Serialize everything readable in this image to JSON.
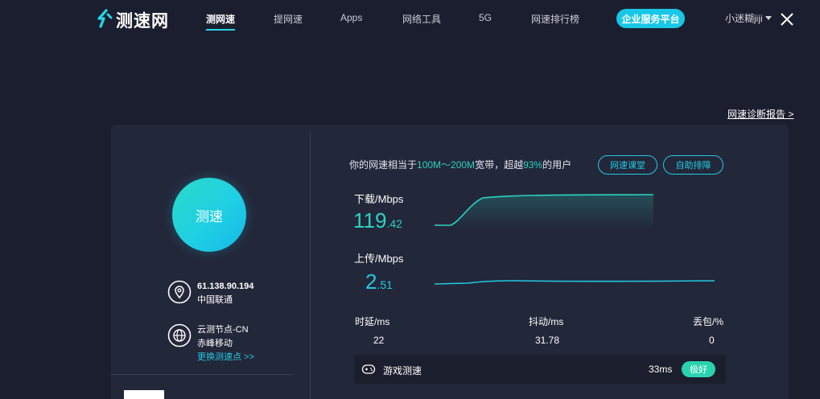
{
  "header": {
    "logo_text": "测速网",
    "nav": [
      "测网速",
      "提网速",
      "Apps",
      "网络工具",
      "5G",
      "网速排行榜"
    ],
    "active_nav": "测网速",
    "enterprise_button": "企业服务平台",
    "user_name": "小迷糊jiji",
    "icons": {
      "logo": "speed-logo-icon",
      "close": "close-icon",
      "user_menu": "chevron-down-icon"
    }
  },
  "report_link": "网速诊断报告 >",
  "test_button": "测速",
  "client": {
    "ip": "61.138.90.194",
    "isp": "中国联通",
    "icon": "location-pin-icon"
  },
  "node": {
    "name": "云测节点-CN",
    "isp": "赤峰移动",
    "change_link": "更换测速点 >>",
    "icon": "globe-icon"
  },
  "summary": {
    "prefix": "你的网速相当于",
    "bandwidth": "100M～200M",
    "middle": "宽带，超越",
    "percent": "93%",
    "suffix": "的用户"
  },
  "buttons": {
    "course": "网速课堂",
    "self_check": "自助排障"
  },
  "download": {
    "label": "下载/Mbps",
    "int": "119",
    "dec": ".42"
  },
  "upload": {
    "label": "上传/Mbps",
    "int": "2",
    "dec": ".51"
  },
  "stats": {
    "latency_label": "时延/ms",
    "latency_value": "22",
    "jitter_label": "抖动/ms",
    "jitter_value": "31.78",
    "loss_label": "丢包/%",
    "loss_value": "0"
  },
  "game": {
    "label": "游戏测速",
    "ms": "33ms",
    "badge": "极好",
    "icon": "gamepad-icon"
  },
  "colors": {
    "accent": "#22c9e2",
    "green": "#2ad3c0",
    "background": "#1b1e2e",
    "card": "#23273a"
  }
}
